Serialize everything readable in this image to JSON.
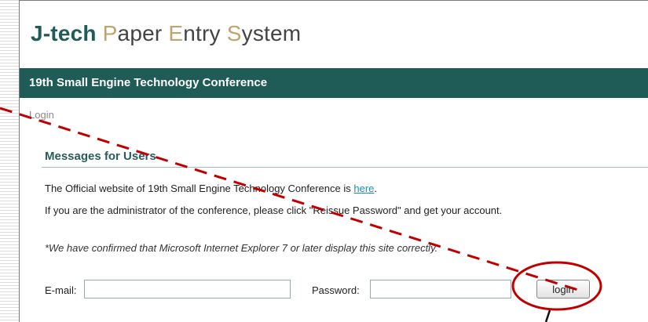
{
  "logo": {
    "j_tech": "J-tech",
    "p": "P",
    "aper": "aper ",
    "e": "E",
    "ntry": "ntry ",
    "s": "S",
    "ystem": "ystem"
  },
  "header": {
    "title": "19th Small Engine Technology Conference"
  },
  "breadcrumb": {
    "label": "Login"
  },
  "messages": {
    "heading": "Messages for Users",
    "line1_prefix": "The Official website of 19th Small Engine Technology Conference is ",
    "line1_link": "here",
    "line1_suffix": ".",
    "line2": "If you are the administrator of the conference, please click \"Reissue Password\" and get your account.",
    "note": "*We have confirmed that Microsoft Internet Explorer 7 or later display this site correctly."
  },
  "login": {
    "email_label": "E-mail:",
    "email_value": "",
    "password_label": "Password:",
    "password_value": "",
    "button_label": "login"
  },
  "colors": {
    "brand": "#1f5c57",
    "link": "#1a8fb5",
    "annotation": "#c00000"
  }
}
